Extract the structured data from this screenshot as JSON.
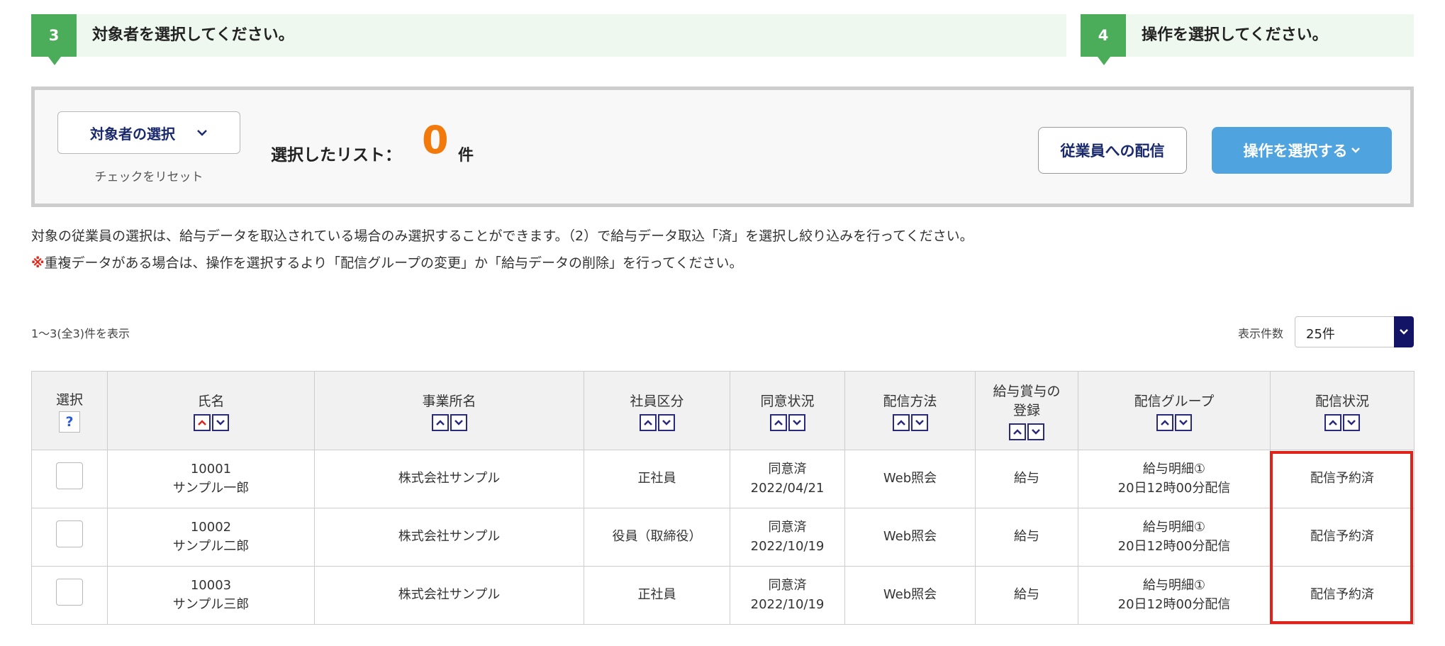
{
  "steps": [
    {
      "num": "3",
      "title": "対象者を選択してください。"
    },
    {
      "num": "4",
      "title": "操作を選択してください。"
    }
  ],
  "panel": {
    "select_button": "対象者の選択",
    "reset_link": "チェックをリセット",
    "selected_label": "選択したリスト：",
    "selected_count": "0",
    "selected_unit": "件",
    "deliver_button": "従業員への配信",
    "operate_button": "操作を選択する"
  },
  "notices": {
    "line1": "対象の従業員の選択は、給与データを取込されている場合のみ選択することができます。（2）で給与データ取込「済」を選択し絞り込みを行ってください。",
    "mark": "※",
    "line2": "重複データがある場合は、操作を選択するより「配信グループの変更」か「給与データの削除」を行ってください。"
  },
  "list": {
    "range_text": "1〜3(全3)件を表示",
    "per_page_label": "表示件数",
    "per_page_value": "25件"
  },
  "table": {
    "headers": {
      "select": "選択",
      "help": "?",
      "name": "氏名",
      "office": "事業所名",
      "type": "社員区分",
      "consent": "同意状況",
      "method": "配信方法",
      "reg1": "給与賞与の",
      "reg2": "登録",
      "group": "配信グループ",
      "status": "配信状況"
    },
    "rows": [
      {
        "id": "10001",
        "name": "サンプル一郎",
        "office": "株式会社サンプル",
        "type": "正社員",
        "consent": "同意済",
        "consent_date": "2022/04/21",
        "method": "Web照会",
        "reg": "給与",
        "group": "給与明細①",
        "group_time": "20日12時00分配信",
        "status": "配信予約済"
      },
      {
        "id": "10002",
        "name": "サンプル二郎",
        "office": "株式会社サンプル",
        "type": "役員（取締役）",
        "consent": "同意済",
        "consent_date": "2022/10/19",
        "method": "Web照会",
        "reg": "給与",
        "group": "給与明細①",
        "group_time": "20日12時00分配信",
        "status": "配信予約済"
      },
      {
        "id": "10003",
        "name": "サンプル三郎",
        "office": "株式会社サンプル",
        "type": "正社員",
        "consent": "同意済",
        "consent_date": "2022/10/19",
        "method": "Web照会",
        "reg": "給与",
        "group": "給与明細①",
        "group_time": "20日12時00分配信",
        "status": "配信予約済"
      }
    ]
  },
  "colors": {
    "step_green": "#4bac5a",
    "count_orange": "#f27a0c",
    "primary_blue": "#4fa3df",
    "highlight_red": "#e1221b",
    "sort_active_red": "#d9261c"
  }
}
